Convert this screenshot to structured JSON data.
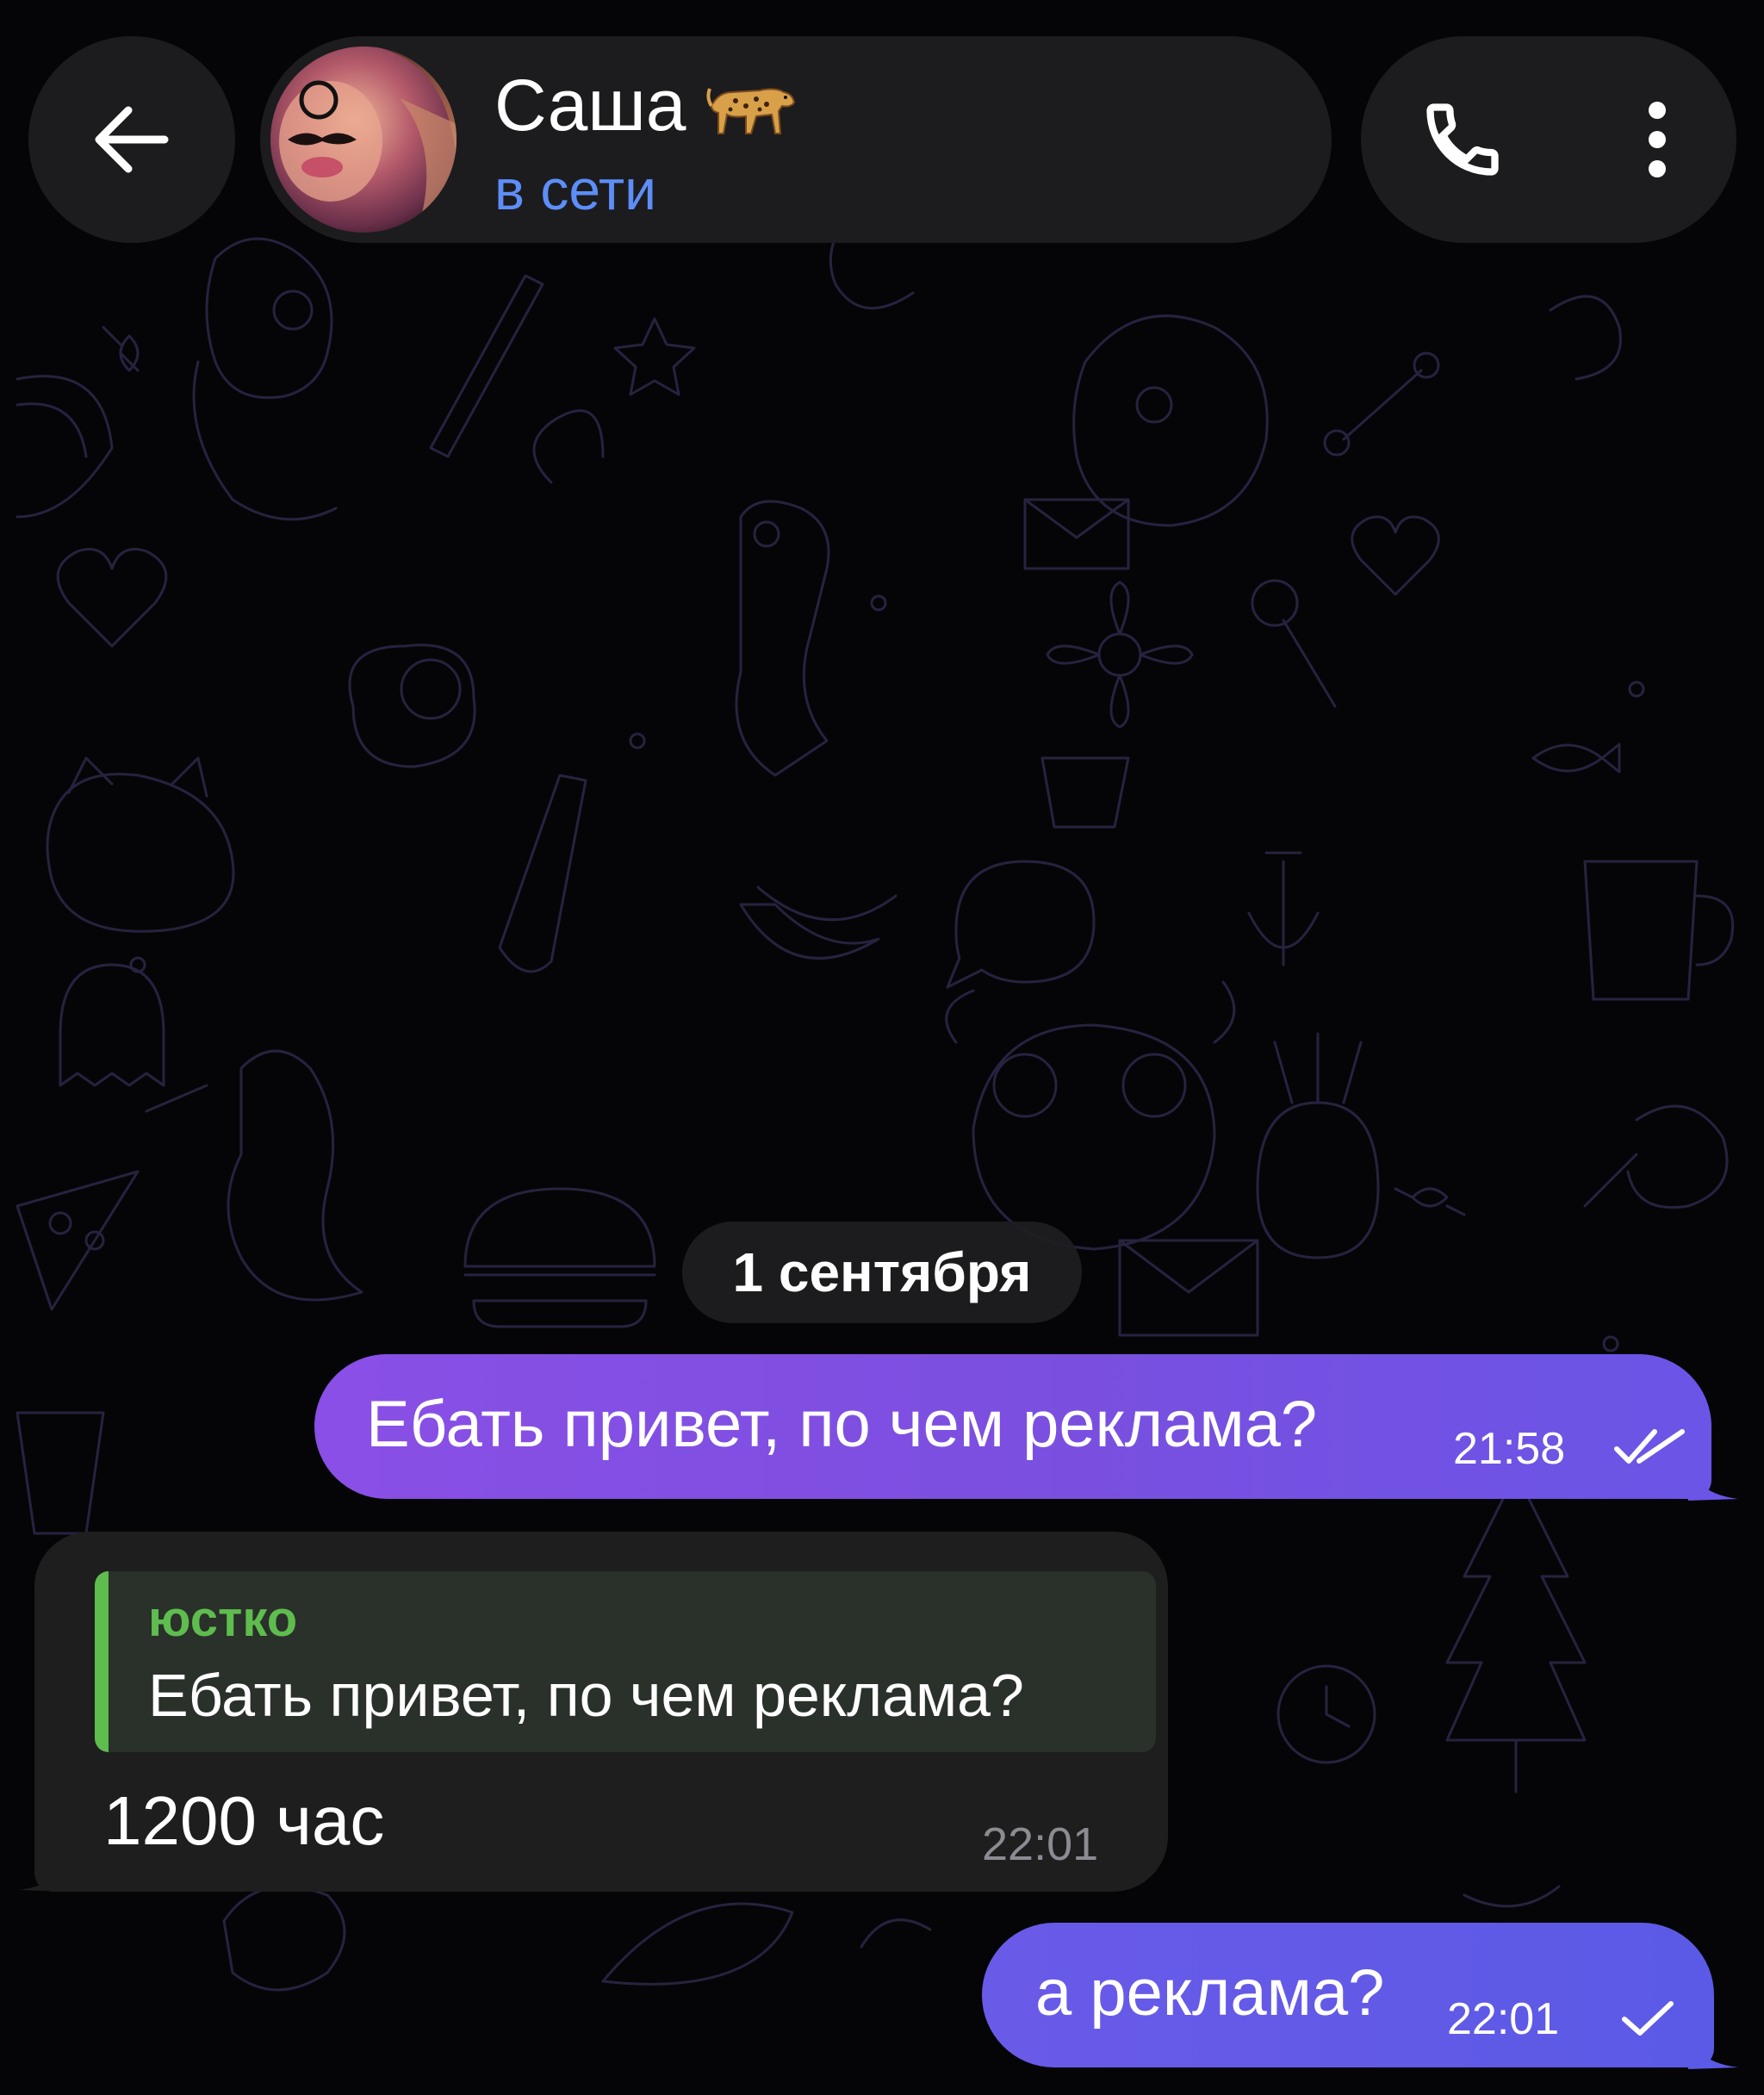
{
  "header": {
    "contact_name": "Саша",
    "contact_emoji": "leopard-icon",
    "status": "в сети"
  },
  "icons": {
    "back": "arrow-left-icon",
    "call": "phone-icon",
    "menu": "more-vertical-icon"
  },
  "chat": {
    "date_separator": "1 сентября",
    "messages": [
      {
        "direction": "outgoing",
        "text": "Ебать привет, по чем реклама?",
        "time": "21:58",
        "status": "read"
      },
      {
        "direction": "incoming",
        "reply_to": {
          "author": "юстко",
          "text": "Ебать привет, по чем реклама?"
        },
        "text": "1200 час",
        "time": "22:01"
      },
      {
        "direction": "outgoing",
        "text": "а реклама?",
        "time": "22:01",
        "status": "sent"
      }
    ]
  },
  "colors": {
    "background": "#050507",
    "header_pill": "#1c1c1e",
    "status_blue": "#5d8ef8",
    "outgoing_bubble": "#7a4fe0",
    "incoming_bubble": "#1e1e1f",
    "reply_accent": "#5fbc4e"
  }
}
